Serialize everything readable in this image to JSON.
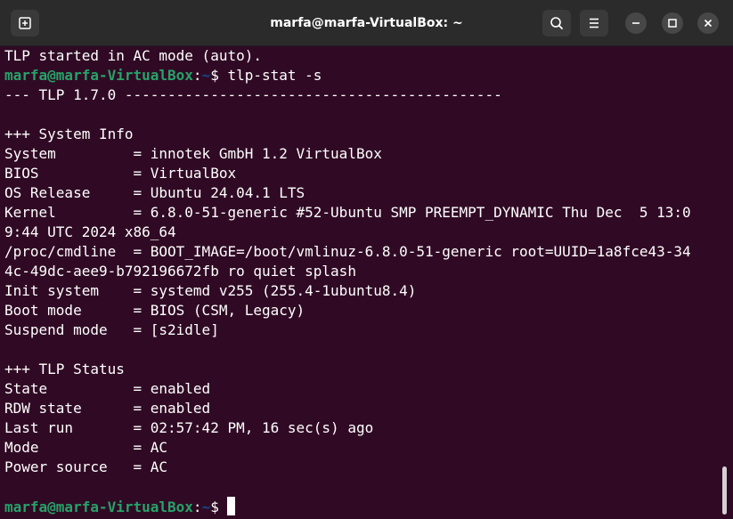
{
  "window": {
    "title": "marfa@marfa-VirtualBox: ~"
  },
  "titlebar": {
    "new_tab_icon": "new-tab-icon",
    "search_icon": "search-icon",
    "menu_icon": "hamburger-menu-icon",
    "minimize_icon": "minimize-icon",
    "maximize_icon": "maximize-icon",
    "close_icon": "close-icon"
  },
  "colors": {
    "background": "#300a24",
    "prompt_user": "#26a269",
    "prompt_path": "#12488b",
    "text": "#ffffff"
  },
  "terminal": {
    "line0": "TLP started in AC mode (auto).",
    "prompt1_user": "marfa@marfa-VirtualBox",
    "prompt1_sep": ":",
    "prompt1_path": "~",
    "prompt1_cmd": "$ tlp-stat -s",
    "line2": "--- TLP 1.7.0 --------------------------------------------",
    "line3": "",
    "line4": "+++ System Info",
    "line5": "System         = innotek GmbH 1.2 VirtualBox",
    "line6": "BIOS           = VirtualBox",
    "line7": "OS Release     = Ubuntu 24.04.1 LTS",
    "line8": "Kernel         = 6.8.0-51-generic #52-Ubuntu SMP PREEMPT_DYNAMIC Thu Dec  5 13:0",
    "line9": "9:44 UTC 2024 x86_64",
    "line10": "/proc/cmdline  = BOOT_IMAGE=/boot/vmlinuz-6.8.0-51-generic root=UUID=1a8fce43-34",
    "line11": "4c-49dc-aee9-b792196672fb ro quiet splash",
    "line12": "Init system    = systemd v255 (255.4-1ubuntu8.4)",
    "line13": "Boot mode      = BIOS (CSM, Legacy)",
    "line14": "Suspend mode   = [s2idle]",
    "line15": "",
    "line16": "+++ TLP Status",
    "line17": "State          = enabled",
    "line18": "RDW state      = enabled",
    "line19": "Last run       = 02:57:42 PM, 16 sec(s) ago",
    "line20": "Mode           = AC",
    "line21": "Power source   = AC",
    "line22": "",
    "prompt2_user": "marfa@marfa-VirtualBox",
    "prompt2_sep": ":",
    "prompt2_path": "~",
    "prompt2_cmd": "$ "
  }
}
